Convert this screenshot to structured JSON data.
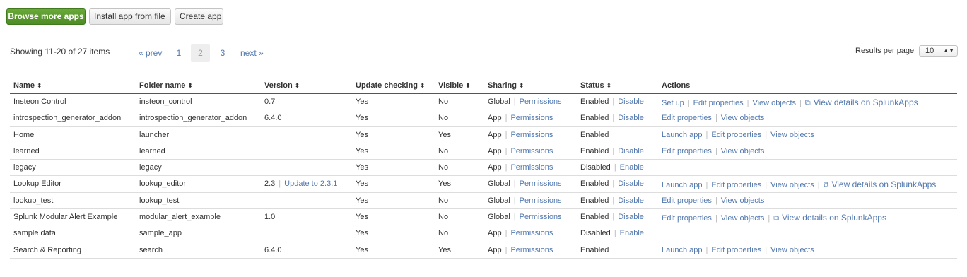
{
  "buttons": {
    "browse": "Browse more apps",
    "install": "Install app from file",
    "create": "Create app"
  },
  "paging": {
    "showing": "Showing 11-20 of 27 items",
    "prev": "« prev",
    "pages": [
      "1",
      "2",
      "3"
    ],
    "current": "2",
    "next": "next »"
  },
  "results_per_page": {
    "label": "Results per page",
    "value": "10"
  },
  "icons": {
    "sort": "⬍",
    "caret": "▲▼",
    "external": "⧉"
  },
  "columns": {
    "name": "Name",
    "folder": "Folder name",
    "version": "Version",
    "update": "Update checking",
    "visible": "Visible",
    "sharing": "Sharing",
    "status": "Status",
    "actions": "Actions"
  },
  "rows": [
    {
      "name": "Insteon Control",
      "folder": "insteon_control",
      "version": "0.7",
      "version_link": "",
      "update": "Yes",
      "visible": "No",
      "sharing": "Global",
      "sharing_link": "Permissions",
      "status": "Enabled",
      "status_link": "Disable",
      "actions": [
        "Set up",
        "Edit properties",
        "View objects"
      ],
      "external": "View details on SplunkApps"
    },
    {
      "name": "introspection_generator_addon",
      "folder": "introspection_generator_addon",
      "version": "6.4.0",
      "version_link": "",
      "update": "Yes",
      "visible": "No",
      "sharing": "App",
      "sharing_link": "Permissions",
      "status": "Enabled",
      "status_link": "Disable",
      "actions": [
        "Edit properties",
        "View objects"
      ],
      "external": ""
    },
    {
      "name": "Home",
      "folder": "launcher",
      "version": "",
      "version_link": "",
      "update": "Yes",
      "visible": "Yes",
      "sharing": "App",
      "sharing_link": "Permissions",
      "status": "Enabled",
      "status_link": "",
      "actions": [
        "Launch app",
        "Edit properties",
        "View objects"
      ],
      "external": ""
    },
    {
      "name": "learned",
      "folder": "learned",
      "version": "",
      "version_link": "",
      "update": "Yes",
      "visible": "No",
      "sharing": "App",
      "sharing_link": "Permissions",
      "status": "Enabled",
      "status_link": "Disable",
      "actions": [
        "Edit properties",
        "View objects"
      ],
      "external": ""
    },
    {
      "name": "legacy",
      "folder": "legacy",
      "version": "",
      "version_link": "",
      "update": "Yes",
      "visible": "No",
      "sharing": "App",
      "sharing_link": "Permissions",
      "status": "Disabled",
      "status_link": "Enable",
      "actions": [],
      "external": ""
    },
    {
      "name": "Lookup Editor",
      "folder": "lookup_editor",
      "version": "2.3",
      "version_link": "Update to 2.3.1",
      "update": "Yes",
      "visible": "Yes",
      "sharing": "Global",
      "sharing_link": "Permissions",
      "status": "Enabled",
      "status_link": "Disable",
      "actions": [
        "Launch app",
        "Edit properties",
        "View objects"
      ],
      "external": "View details on SplunkApps"
    },
    {
      "name": "lookup_test",
      "folder": "lookup_test",
      "version": "",
      "version_link": "",
      "update": "Yes",
      "visible": "No",
      "sharing": "Global",
      "sharing_link": "Permissions",
      "status": "Enabled",
      "status_link": "Disable",
      "actions": [
        "Edit properties",
        "View objects"
      ],
      "external": ""
    },
    {
      "name": "Splunk Modular Alert Example",
      "folder": "modular_alert_example",
      "version": "1.0",
      "version_link": "",
      "update": "Yes",
      "visible": "No",
      "sharing": "Global",
      "sharing_link": "Permissions",
      "status": "Enabled",
      "status_link": "Disable",
      "actions": [
        "Edit properties",
        "View objects"
      ],
      "external": "View details on SplunkApps"
    },
    {
      "name": "sample data",
      "folder": "sample_app",
      "version": "",
      "version_link": "",
      "update": "Yes",
      "visible": "No",
      "sharing": "App",
      "sharing_link": "Permissions",
      "status": "Disabled",
      "status_link": "Enable",
      "actions": [],
      "external": ""
    },
    {
      "name": "Search & Reporting",
      "folder": "search",
      "version": "6.4.0",
      "version_link": "",
      "update": "Yes",
      "visible": "Yes",
      "sharing": "App",
      "sharing_link": "Permissions",
      "status": "Enabled",
      "status_link": "",
      "actions": [
        "Launch app",
        "Edit properties",
        "View objects"
      ],
      "external": ""
    }
  ]
}
